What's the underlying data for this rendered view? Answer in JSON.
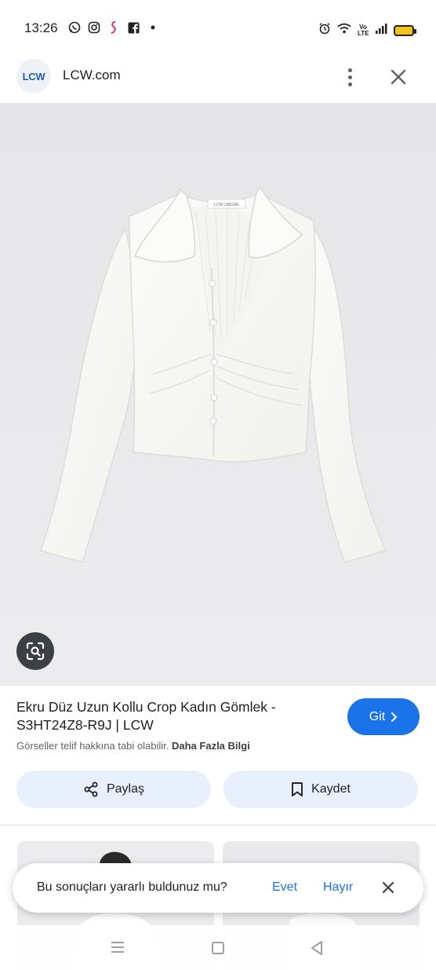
{
  "status_bar": {
    "time": "13:26",
    "left_icons": [
      "whatsapp-icon",
      "instagram-icon",
      "app-icon",
      "facebook-icon",
      "dot-icon"
    ],
    "right_icons": [
      "alarm-icon",
      "wifi-icon",
      "volte-icon",
      "signal-icon",
      "battery-icon"
    ],
    "volte_label": "Vo LTE",
    "battery_color": "#f6c21b"
  },
  "header": {
    "logo_text": "LCW",
    "site_name": "LCW.com",
    "more_icon": "more-vert-icon",
    "close_icon": "close-icon"
  },
  "image": {
    "tag_text": "LCW CASUAL",
    "lens_icon": "lens-search-icon"
  },
  "result": {
    "title": "Ekru Düz Uzun Kollu Crop Kadın Gömlek - S3HT24Z8-R9J | LCW",
    "visit_label": "Git",
    "copyright_text": "Görseller telif hakkına tabi olabilir.",
    "more_info_label": "Daha Fazla Bilgi"
  },
  "actions": {
    "share_label": "Paylaş",
    "save_label": "Kaydet"
  },
  "feedback": {
    "question": "Bu sonuçları yararlı buldunuz mu?",
    "yes_label": "Evet",
    "no_label": "Hayır"
  },
  "colors": {
    "accent": "#1a73e8",
    "action_bg": "#e8f0fe",
    "image_bg": "#e8e8ea"
  }
}
